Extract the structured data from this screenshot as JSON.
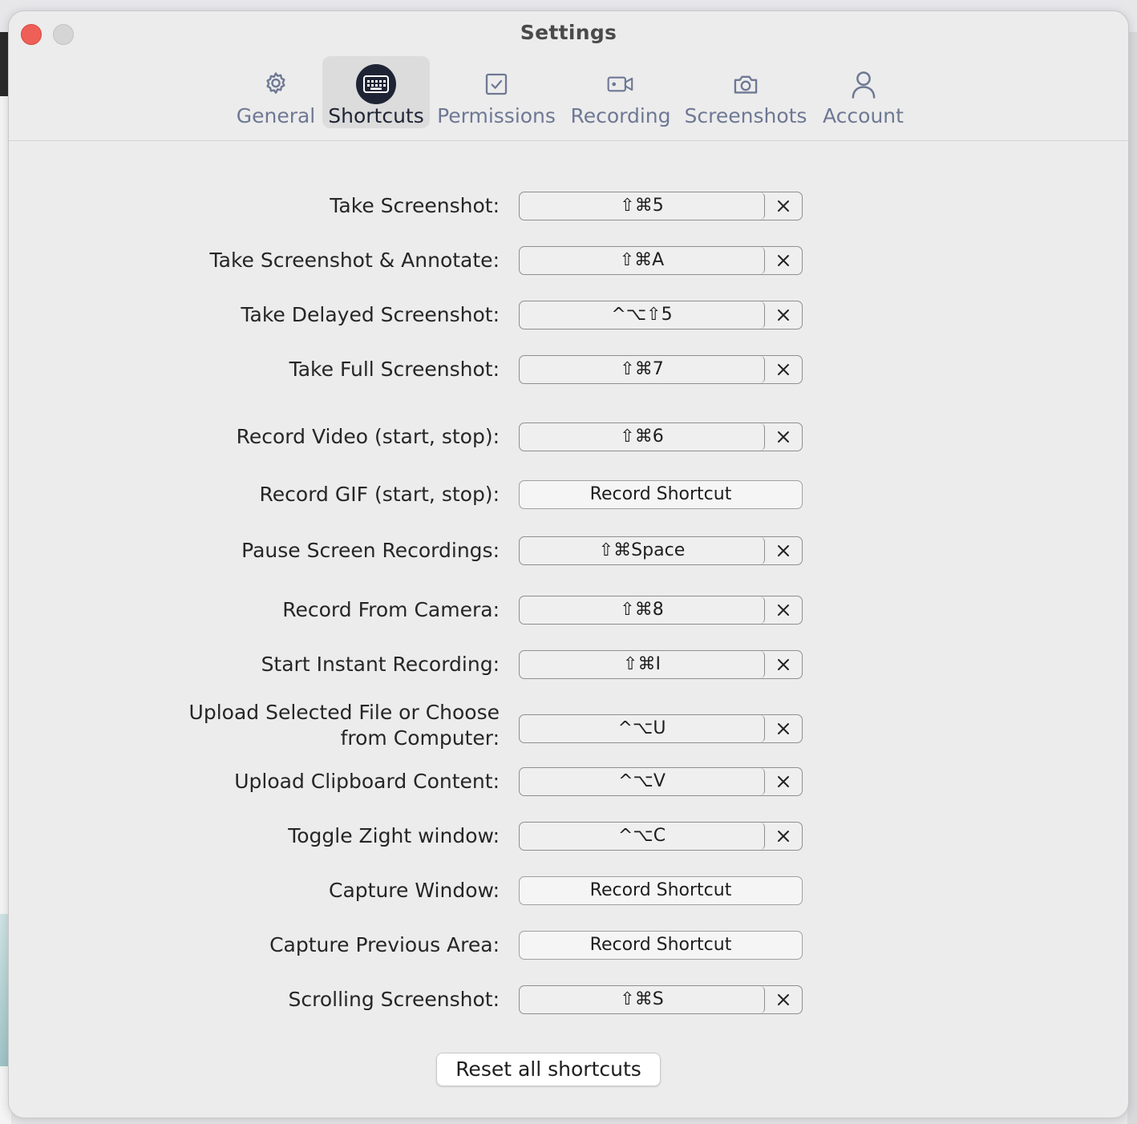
{
  "window": {
    "title": "Settings"
  },
  "tabs": [
    {
      "label": "General",
      "icon": "gear-icon",
      "active": false
    },
    {
      "label": "Shortcuts",
      "icon": "keyboard-icon",
      "active": true
    },
    {
      "label": "Permissions",
      "icon": "checkbox-icon",
      "active": false
    },
    {
      "label": "Recording",
      "icon": "video-camera-icon",
      "active": false
    },
    {
      "label": "Screenshots",
      "icon": "camera-icon",
      "active": false
    },
    {
      "label": "Account",
      "icon": "user-icon",
      "active": false
    }
  ],
  "shortcuts": [
    {
      "label": "Take Screenshot:",
      "keys": "⇧⌘5"
    },
    {
      "label": "Take Screenshot & Annotate:",
      "keys": "⇧⌘A"
    },
    {
      "label": "Take Delayed Screenshot:",
      "keys": "^⌥⇧5"
    },
    {
      "label": "Take Full Screenshot:",
      "keys": "⇧⌘7"
    },
    {
      "label": "Record Video (start, stop):",
      "keys": "⇧⌘6"
    },
    {
      "label": "Record GIF (start, stop):",
      "keys": "",
      "record_label": "Record Shortcut"
    },
    {
      "label": "Pause Screen Recordings:",
      "keys": "⇧⌘Space"
    },
    {
      "label": "Record From Camera:",
      "keys": "⇧⌘8"
    },
    {
      "label": "Start Instant Recording:",
      "keys": "⇧⌘I"
    },
    {
      "label": "Upload Selected File or Choose",
      "label_line2": "from Computer:",
      "keys": "^⌥U"
    },
    {
      "label": "Upload Clipboard Content:",
      "keys": "^⌥V"
    },
    {
      "label": "Toggle Zight window:",
      "keys": "^⌥C"
    },
    {
      "label": "Capture Window:",
      "keys": "",
      "record_label": "Record Shortcut"
    },
    {
      "label": "Capture Previous Area:",
      "keys": "",
      "record_label": "Record Shortcut"
    },
    {
      "label": "Scrolling Screenshot:",
      "keys": "⇧⌘S"
    }
  ],
  "reset_button": "Reset all shortcuts"
}
